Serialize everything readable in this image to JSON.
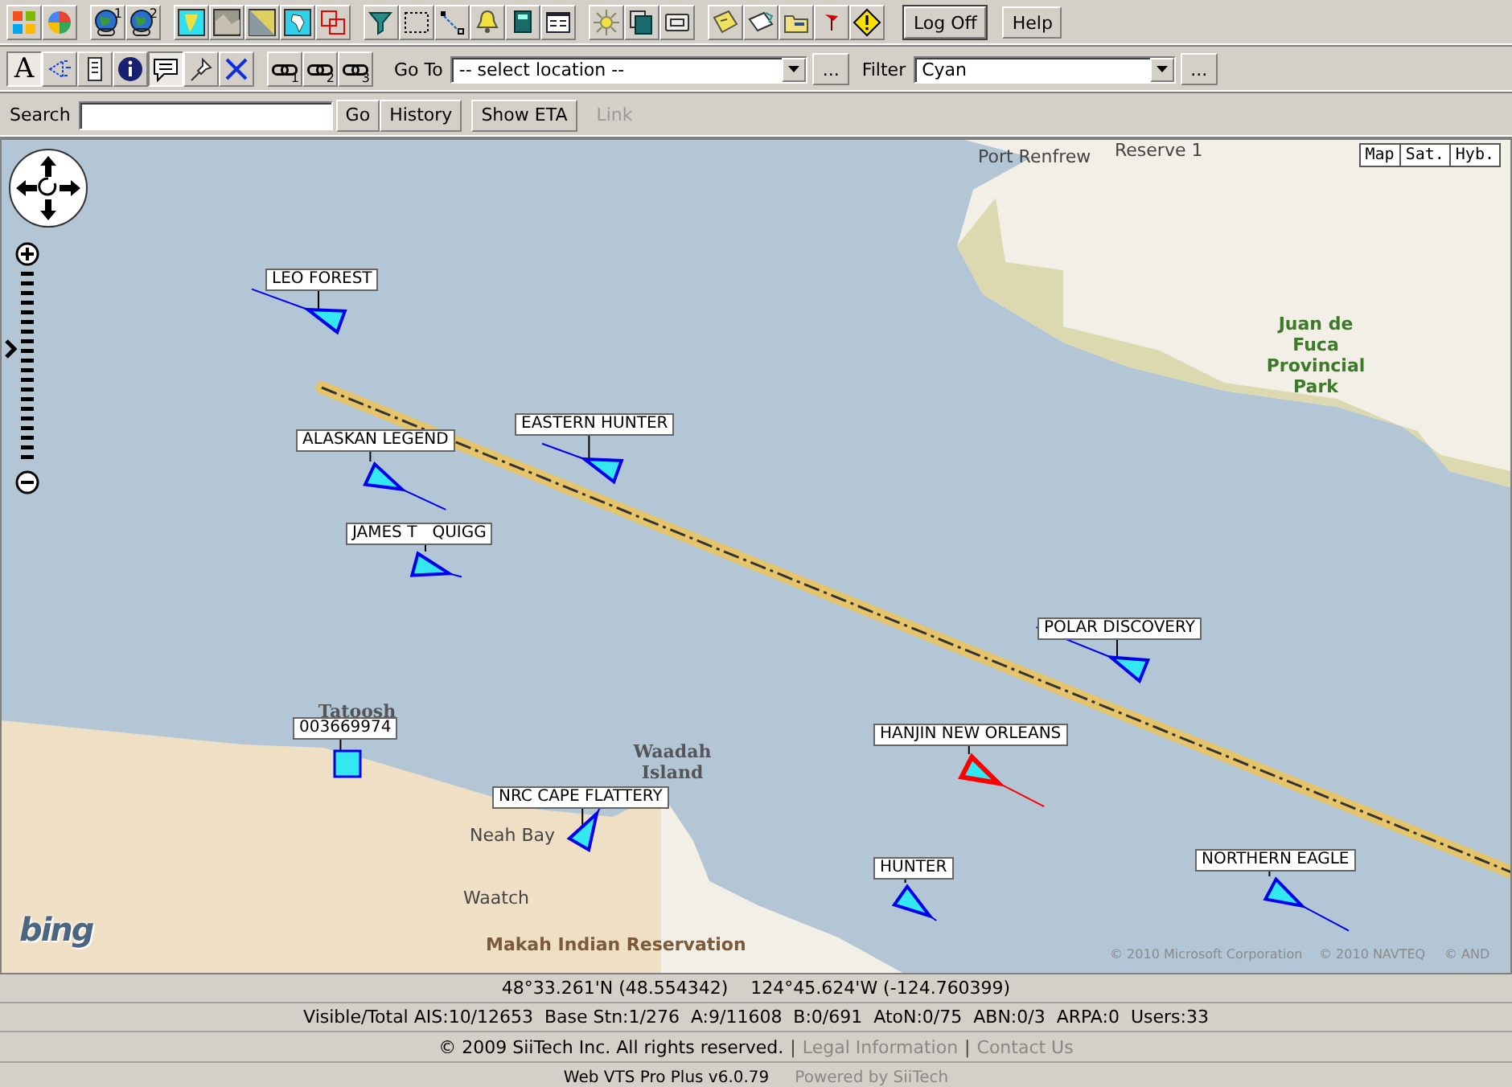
{
  "toolbar_1": {
    "icon_badges": [
      "1",
      "2"
    ],
    "buttons": [
      "Log Off",
      "Help"
    ]
  },
  "toolbar_2": {
    "tools": [
      {
        "label": "A",
        "pressed": true
      },
      {
        "pressed": false
      },
      {
        "pressed": false
      },
      {
        "pressed": false
      },
      {
        "pressed": true
      },
      {
        "pressed": false
      },
      {
        "pressed": false
      }
    ],
    "link_badges": [
      "1",
      "2",
      "3"
    ],
    "goto_label": "Go To",
    "goto_value": "-- select location --",
    "goto_more": "...",
    "filter_label": "Filter",
    "filter_value": "Cyan",
    "filter_more": "..."
  },
  "search_bar": {
    "label": "Search",
    "go": "Go",
    "history": "History",
    "show_eta": "Show ETA",
    "link": {
      "label": "Link",
      "disabled": true
    }
  },
  "map": {
    "view_buttons": [
      "Map",
      "Sat.",
      "Hyb."
    ],
    "places": [
      {
        "kind": "town",
        "text": "Port Renfrew"
      },
      {
        "kind": "town",
        "text": "Reserve 1"
      },
      {
        "kind": "park",
        "text": "Juan de Fuca Provincial Park"
      },
      {
        "kind": "island",
        "text": "Tatoosh"
      },
      {
        "kind": "island",
        "text": "Waadah Island"
      },
      {
        "kind": "town",
        "text": "Neah Bay"
      },
      {
        "kind": "town",
        "text": "Waatch"
      },
      {
        "kind": "logo",
        "text": "bing"
      },
      {
        "kind": "reservation",
        "text": "Makah Indian Reservation"
      },
      {
        "kind": "attribution",
        "text": "© 2010 Microsoft Corporation"
      },
      {
        "kind": "attribution",
        "text": "© 2010 NAVTEQ"
      },
      {
        "kind": "attribution",
        "text": "© AND"
      }
    ],
    "vessels": [
      {
        "name": "LEO FOREST",
        "kind": "ship",
        "selected": false
      },
      {
        "name": "EASTERN HUNTER",
        "kind": "ship",
        "selected": false
      },
      {
        "name": "ALASKAN LEGEND",
        "kind": "ship",
        "selected": false
      },
      {
        "name": "JAMES T   QUIGG",
        "kind": "ship",
        "selected": false
      },
      {
        "name": "POLAR DISCOVERY",
        "kind": "ship",
        "selected": false
      },
      {
        "name": "003669974",
        "kind": "station",
        "selected": false
      },
      {
        "name": "HANJIN NEW ORLEANS",
        "kind": "ship",
        "selected": true
      },
      {
        "name": "NRC CAPE FLATTERY",
        "kind": "ship",
        "selected": false
      },
      {
        "name": "HUNTER",
        "kind": "ship",
        "selected": false
      },
      {
        "name": "NORTHERN EAGLE",
        "kind": "ship",
        "selected": false
      }
    ]
  },
  "status_bar": {
    "position": "48°33.261'N (48.554342)    124°45.624'W (-124.760399)",
    "counts": "Visible/Total AIS:10/12653  Base Stn:1/276  A:9/11608  B:0/691  AtoN:0/75  ABN:0/3  ARPA:0  Users:33",
    "footer": [
      {
        "kind": "text",
        "text": "© 2009 SiiTech Inc. All rights reserved."
      },
      {
        "kind": "sep",
        "text": "|"
      },
      {
        "kind": "link",
        "text": "Legal Information"
      },
      {
        "kind": "sep",
        "text": "|"
      },
      {
        "kind": "link",
        "text": "Contact Us"
      }
    ],
    "version": "Web VTS Pro Plus v6.0.79",
    "powered_by": "Powered by SiiTech"
  }
}
